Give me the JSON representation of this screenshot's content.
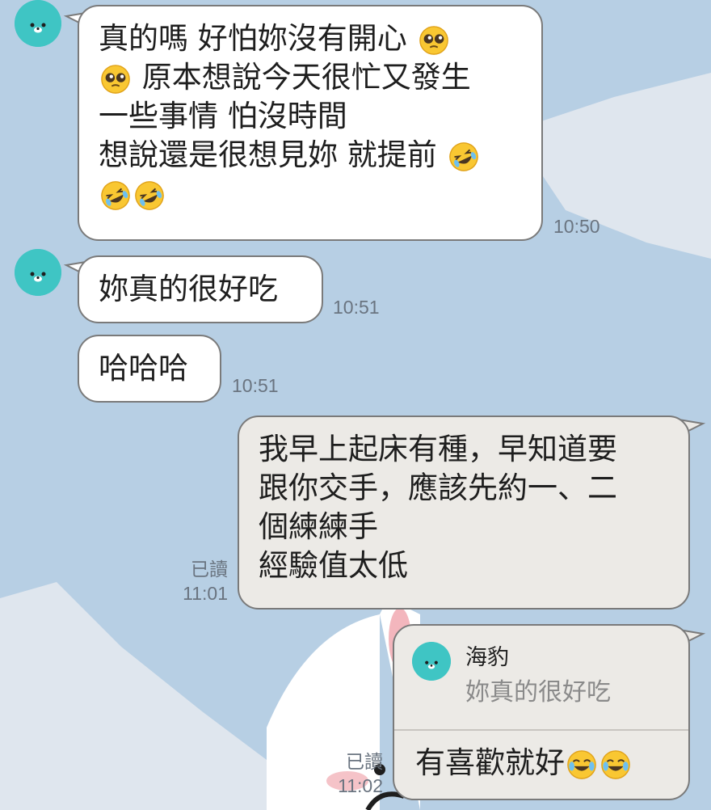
{
  "colors": {
    "chat_background": "#b7cfe4",
    "incoming_bubble": "#ffffff",
    "outgoing_bubble": "#eceae6",
    "avatar": "#3fc5c4"
  },
  "contact": {
    "name": "海豹",
    "avatar_icon": "seal-avatar-icon"
  },
  "messages": [
    {
      "lines": [
        "真的嗎 好怕妳沒有開心",
        "原本想說今天很忙又發生",
        "一些事情 怕沒時間",
        "想說還是很想見妳 就提前"
      ],
      "emoji_icons": [
        "pleading-face-emoji",
        "pleading-face-emoji",
        "rofl-emoji",
        "rofl-emoji",
        "rofl-emoji"
      ],
      "time": "10:50"
    },
    {
      "text": "妳真的很好吃",
      "time": "10:51"
    },
    {
      "text": "哈哈哈",
      "time": "10:51"
    },
    {
      "lines": [
        "我早上起床有種，早知道要",
        "跟你交手，應該先約一、二",
        "個練練手",
        "經驗值太低"
      ],
      "read": "已讀",
      "time": "11:01"
    },
    {
      "reply_to": {
        "name": "海豹",
        "text": "妳真的很好吃"
      },
      "text": "有喜歡就好",
      "emoji_icons": [
        "tears-of-joy-emoji",
        "tears-of-joy-emoji"
      ],
      "read": "已讀",
      "time": "11:02"
    }
  ]
}
